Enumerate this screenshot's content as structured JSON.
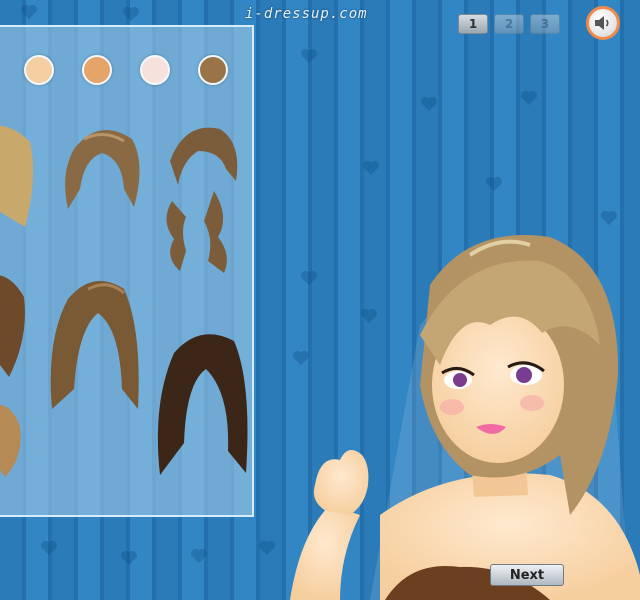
{
  "site": {
    "watermark": "i-dressup.com"
  },
  "pager": {
    "pages": [
      "1",
      "2",
      "3"
    ],
    "current": "1"
  },
  "sound": {
    "icon": "speaker-icon"
  },
  "skin_tones": [
    "#f3cfa2",
    "#e5a56a",
    "#f7e1dd",
    "#9a7449"
  ],
  "hair_options": [
    {
      "id": "short-ash-bob",
      "color": "#8a6a44"
    },
    {
      "id": "curly-ash-bob",
      "color": "#7c5d3b"
    },
    {
      "id": "long-wavy-brown",
      "color": "#7a5a34"
    },
    {
      "id": "long-curly-dark",
      "color": "#3c2618"
    }
  ],
  "buttons": {
    "next_label": "Next"
  }
}
